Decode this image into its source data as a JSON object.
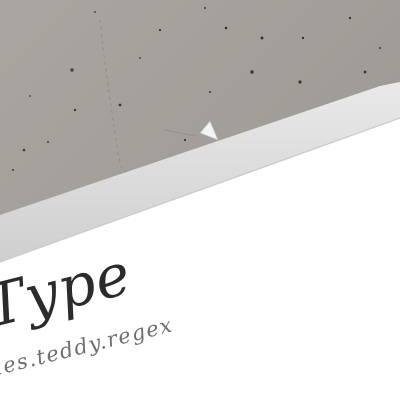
{
  "card": {
    "title": "Type",
    "subtitle": "les.teddy.regex"
  },
  "colors": {
    "concrete": "#a29e99",
    "concrete_dark": "#8f8b87",
    "paper": "#ffffff",
    "paper_edge": "#dcdcdc",
    "title_text": "#2b2b2b",
    "subtitle_text": "#6e6e6e"
  }
}
